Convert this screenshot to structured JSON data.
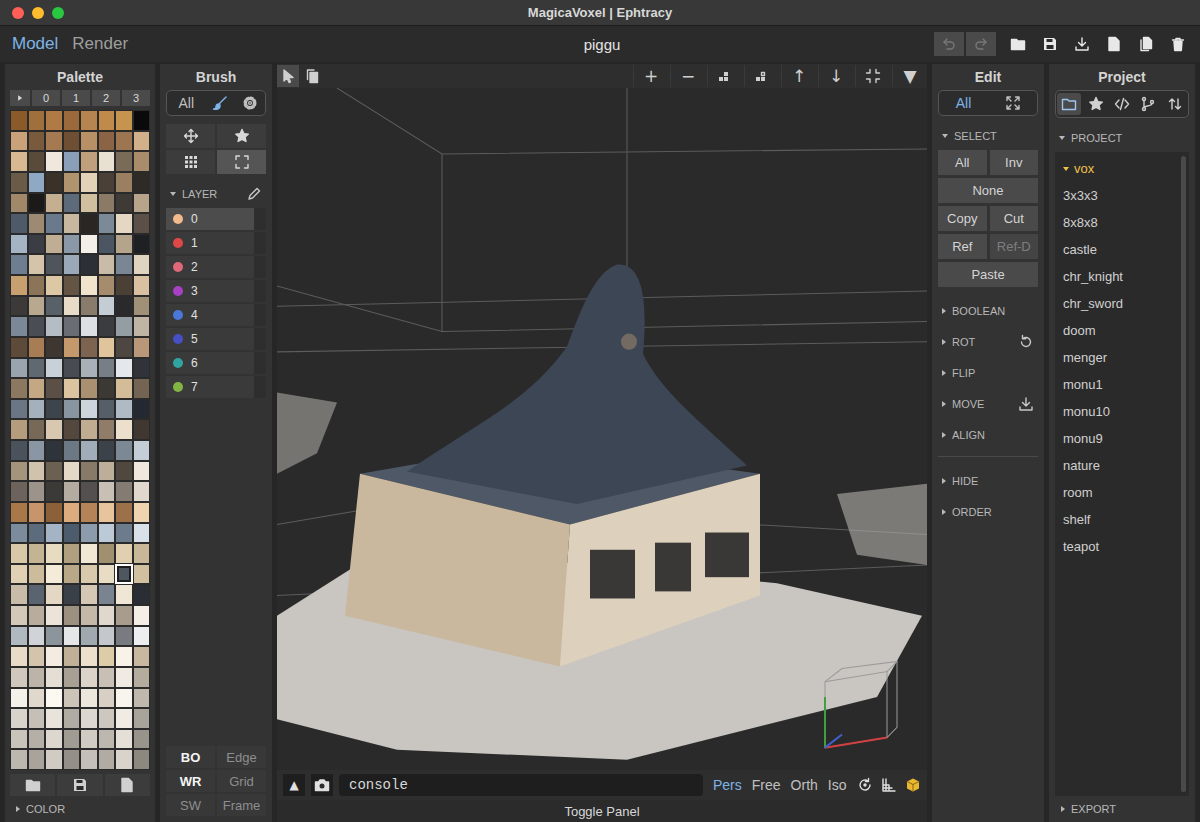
{
  "window": {
    "title": "MagicaVoxel | Ephtracy"
  },
  "mode_tabs": [
    {
      "label": "Model",
      "selected": true
    },
    {
      "label": "Render",
      "selected": false
    }
  ],
  "document": {
    "name": "piggu"
  },
  "history": [
    {
      "kind": "undo",
      "disabled": true
    },
    {
      "kind": "redo",
      "disabled": true
    }
  ],
  "file_actions": [
    {
      "kind": "folder"
    },
    {
      "kind": "save"
    },
    {
      "kind": "download"
    },
    {
      "kind": "file"
    },
    {
      "kind": "files"
    },
    {
      "kind": "trash"
    }
  ],
  "palette": {
    "title": "Palette",
    "pages": [
      {
        "kind": "play",
        "selected": false
      },
      {
        "kind": "text",
        "label": "0",
        "selected": false
      },
      {
        "kind": "text",
        "label": "1",
        "selected": false
      },
      {
        "kind": "text",
        "label": "2",
        "selected": false
      },
      {
        "kind": "text",
        "label": "3",
        "selected": false
      }
    ],
    "rows": [
      [
        "#8b5a2b",
        "#a0703c",
        "#b07a44",
        "#9c6a3a",
        "#b5844f",
        "#c08a4a",
        "#c79450",
        "#0a0a0a"
      ],
      [
        "#c9a27a",
        "#7a5a3c",
        "#a57a52",
        "#6e4f34",
        "#b89066",
        "#8a6444",
        "#9d7550",
        "#d2b08a"
      ],
      [
        "#d8b890",
        "#5a4a3a",
        "#f0e8dc",
        "#8aa0b8",
        "#c0a07c",
        "#e8e0d0",
        "#7a6a58",
        "#a88c6c"
      ],
      [
        "#6a5a48",
        "#8fa8c4",
        "#3a3228",
        "#b0946e",
        "#e2d2b8",
        "#4a4038",
        "#9a8060",
        "#2e2a26"
      ],
      [
        "#a08868",
        "#1c1a18",
        "#c4b090",
        "#5c6a7a",
        "#d0c0a0",
        "#8a7a66",
        "#3e3a36",
        "#b8a48a"
      ],
      [
        "#4e5a68",
        "#9c8a72",
        "#6a7a8c",
        "#c8b8a0",
        "#2a2624",
        "#7c8a98",
        "#e4d8c4",
        "#5a5048"
      ],
      [
        "#a4b4c4",
        "#3a3e44",
        "#c0ae94",
        "#8a98a8",
        "#f4f0e8",
        "#4c5662",
        "#b4a48c",
        "#1e2024"
      ],
      [
        "#6e7e90",
        "#d4c4aa",
        "#50555c",
        "#9aa8b8",
        "#2c3036",
        "#c8bca8",
        "#7a8694",
        "#e0d4c0"
      ],
      [
        "#c8a070",
        "#8c7458",
        "#dcc8a4",
        "#645444",
        "#f0e4cc",
        "#a48c6c",
        "#4a4036",
        "#d8c0a0"
      ],
      [
        "#3c3a38",
        "#b8a890",
        "#586068",
        "#e8dcc8",
        "#8a7c6c",
        "#c4ccd4",
        "#2a2a2c",
        "#a09078"
      ],
      [
        "#7a8898",
        "#4a4e54",
        "#b4bcc4",
        "#6a6e74",
        "#dce0e4",
        "#3a3c40",
        "#949ca4",
        "#c0b4a4"
      ],
      [
        "#5e4a38",
        "#a87c54",
        "#3e3630",
        "#c49a6c",
        "#7c6450",
        "#e0c49c",
        "#4e4640",
        "#b89878"
      ],
      [
        "#9aa4ae",
        "#606870",
        "#c8d0d8",
        "#484c52",
        "#a8b0b8",
        "#787e86",
        "#e4e8ec",
        "#30343a"
      ],
      [
        "#8c7860",
        "#c4a884",
        "#5c5046",
        "#dcc4a0",
        "#a89070",
        "#3c3834",
        "#d4bc98",
        "#746454"
      ],
      [
        "#6a7684",
        "#a4b0bc",
        "#3e444c",
        "#8894a0",
        "#ccd4dc",
        "#565e68",
        "#b0bac4",
        "#242830"
      ],
      [
        "#b49c7c",
        "#786858",
        "#d8c8b0",
        "#54483e",
        "#c0ac90",
        "#907c68",
        "#ece0cc",
        "#403830"
      ],
      [
        "#4a525c",
        "#8a96a4",
        "#2e343a",
        "#6c7884",
        "#a0acb8",
        "#3c424a",
        "#7c8894",
        "#c4ccd6"
      ],
      [
        "#a4947c",
        "#d0c2ac",
        "#6c6052",
        "#e4d8c6",
        "#887a68",
        "#bcae98",
        "#50483e",
        "#f0e8dc"
      ],
      [
        "#6c645c",
        "#9c948a",
        "#3c3a36",
        "#b4aca0",
        "#545050",
        "#c8c0b4",
        "#847c72",
        "#e0d8cc"
      ],
      [
        "#a87848",
        "#c8946c",
        "#8c6038",
        "#dcac7c",
        "#b48458",
        "#e8c49c",
        "#9c7048",
        "#f0d4b0"
      ],
      [
        "#7c8c9c",
        "#5c6c7c",
        "#a4b4c4",
        "#4c5c6c",
        "#8c9cac",
        "#bccad8",
        "#6c7c8c",
        "#d8e0e8"
      ],
      [
        "#d8c8a8",
        "#c4b494",
        "#e8dcc0",
        "#b0a080",
        "#f0e8d4",
        "#a09070",
        "#e0d0b0",
        "#c8b898"
      ],
      [
        "#e0d0b4",
        "#ccbc9c",
        "#f4ecd8",
        "#b8a888",
        "#d8c8ac",
        "#e8dcc4",
        "#4e5660",
        "#d0c0a0"
      ],
      [
        "#c8bca8",
        "#5a6470",
        "#e4d8c4",
        "#3a4048",
        "#d4c8b4",
        "#7a8490",
        "#f0e6d6",
        "#2a2e34"
      ],
      [
        "#d4c8b8",
        "#b8ac9c",
        "#ece4d8",
        "#9c9080",
        "#c4b8a8",
        "#e0d8cc",
        "#a89c8c",
        "#f4eee6"
      ],
      [
        "#b0b8c0",
        "#d0d4d8",
        "#8c949c",
        "#e4e6e8",
        "#a0a8b0",
        "#c4c8cc",
        "#787c80",
        "#eceef0"
      ],
      [
        "#e8dcc8",
        "#d4c4ac",
        "#f4ece0",
        "#c0b098",
        "#ece0cc",
        "#dccca8",
        "#f8f2e8",
        "#c8b8a0"
      ],
      [
        "#d0c8bc",
        "#bcb4a8",
        "#e4ded4",
        "#a8a094",
        "#dcd4c8",
        "#c8c0b4",
        "#f0eae2",
        "#b4ac9c"
      ],
      [
        "#f4f0ea",
        "#e0d8cc",
        "#fcf8f2",
        "#ccc4b8",
        "#ece6dc",
        "#d8d0c4",
        "#f8f4ee",
        "#c0b8ac"
      ],
      [
        "#d8d4cc",
        "#c4c0b8",
        "#e8e4dc",
        "#b0aca4",
        "#dcd8d0",
        "#ccc8c0",
        "#f0ece4",
        "#a8a49c"
      ],
      [
        "#c8c4bc",
        "#b4b0a8",
        "#dcd8d0",
        "#a09c94",
        "#d0ccc4",
        "#bcb8b0",
        "#e4e0d8",
        "#98948c"
      ],
      [
        "#bcb8b0",
        "#a8a49c",
        "#d0ccc4",
        "#948f88",
        "#c4c0b8",
        "#b0aca4",
        "#d8d4cc",
        "#8c8880"
      ]
    ],
    "selected_swatch": {
      "row": 22,
      "col": 6
    },
    "footer": {
      "label": "COLOR",
      "expanded": false
    }
  },
  "brush": {
    "title": "Brush",
    "modes": [
      {
        "kind": "text",
        "label": "All",
        "selected": false
      },
      {
        "kind": "brush",
        "selected": true
      },
      {
        "kind": "gear",
        "selected": false
      }
    ],
    "tools": [
      {
        "kind": "move",
        "selected": false
      },
      {
        "kind": "star",
        "selected": false
      },
      {
        "kind": "grid",
        "selected": false
      },
      {
        "kind": "select",
        "selected": true
      }
    ],
    "layers": {
      "label": "LAYER",
      "expanded": true,
      "items": [
        {
          "label": "0",
          "color": "#f2b98c",
          "selected": true
        },
        {
          "label": "1",
          "color": "#e04848",
          "selected": false
        },
        {
          "label": "2",
          "color": "#e06878",
          "selected": false
        },
        {
          "label": "3",
          "color": "#a840c4",
          "selected": false
        },
        {
          "label": "4",
          "color": "#4a78d8",
          "selected": false
        },
        {
          "label": "5",
          "color": "#4650c4",
          "selected": false
        },
        {
          "label": "6",
          "color": "#30a4a0",
          "selected": false
        },
        {
          "label": "7",
          "color": "#84b444",
          "selected": false
        }
      ]
    },
    "view_options": [
      {
        "label": "BO",
        "on": true
      },
      {
        "label": "Edge",
        "on": false
      },
      {
        "label": "WR",
        "on": true
      },
      {
        "label": "Grid",
        "on": false
      },
      {
        "label": "SW",
        "on": false
      },
      {
        "label": "Frame",
        "on": false
      }
    ]
  },
  "viewport": {
    "tools": [
      {
        "kind": "cursor",
        "selected": true
      },
      {
        "kind": "copy",
        "selected": false
      }
    ],
    "view_buttons": [
      {
        "kind": "glyph",
        "label": "+"
      },
      {
        "kind": "glyph",
        "label": "−"
      },
      {
        "kind": "voxel-in"
      },
      {
        "kind": "voxel-out"
      },
      {
        "kind": "glyph",
        "label": "↑"
      },
      {
        "kind": "glyph",
        "label": "↓"
      },
      {
        "kind": "fit"
      },
      {
        "kind": "glyph",
        "label": "▼"
      }
    ],
    "panel_button": {
      "label": "▲"
    },
    "console": {
      "placeholder": "console"
    },
    "projections": [
      {
        "label": "Pers",
        "selected": true
      },
      {
        "label": "Free",
        "selected": false
      },
      {
        "label": "Orth",
        "selected": false
      },
      {
        "label": "Iso",
        "selected": false
      }
    ],
    "view_icons": [
      {
        "kind": "rotate"
      },
      {
        "kind": "plane"
      },
      {
        "kind": "cube"
      }
    ],
    "toggle": {
      "label": "Toggle Panel"
    }
  },
  "edit": {
    "title": "Edit",
    "modes": [
      {
        "kind": "text",
        "label": "All",
        "selected": true
      },
      {
        "kind": "expand",
        "selected": false
      }
    ],
    "select": {
      "label": "SELECT",
      "expanded": true,
      "rows": [
        [
          {
            "label": "All",
            "disabled": false
          },
          {
            "label": "Inv",
            "disabled": false
          }
        ],
        [
          {
            "label": "None",
            "disabled": false
          }
        ],
        [
          {
            "label": "Copy",
            "disabled": false
          },
          {
            "label": "Cut",
            "disabled": false
          }
        ],
        [
          {
            "label": "Ref",
            "disabled": false
          },
          {
            "label": "Ref-D",
            "disabled": true
          }
        ],
        [
          {
            "label": "Paste",
            "disabled": false
          }
        ]
      ]
    },
    "section_groups": [
      [
        {
          "label": "BOOLEAN",
          "expanded": false,
          "kind": "plain"
        },
        {
          "label": "ROT",
          "expanded": false,
          "kind": "reset"
        },
        {
          "label": "FLIP",
          "expanded": false,
          "kind": "plain"
        },
        {
          "label": "MOVE",
          "expanded": false,
          "kind": "download"
        },
        {
          "label": "ALIGN",
          "expanded": false,
          "kind": "plain"
        }
      ],
      [
        {
          "label": "HIDE",
          "expanded": false,
          "kind": "plain"
        },
        {
          "label": "ORDER",
          "expanded": false,
          "kind": "plain"
        }
      ]
    ]
  },
  "project": {
    "title": "Project",
    "tabs": [
      {
        "kind": "folder-outline",
        "selected": true
      },
      {
        "kind": "star",
        "selected": false
      },
      {
        "kind": "code",
        "selected": false
      },
      {
        "kind": "tree",
        "selected": false
      },
      {
        "kind": "sort",
        "selected": false
      }
    ],
    "section": {
      "label": "PROJECT",
      "expanded": true
    },
    "folder": {
      "label": "vox",
      "expanded": true,
      "selected": true
    },
    "files": [
      "3x3x3",
      "8x8x8",
      "castle",
      "chr_knight",
      "chr_sword",
      "doom",
      "menger",
      "monu1",
      "monu10",
      "monu9",
      "nature",
      "room",
      "shelf",
      "teapot"
    ],
    "footer": {
      "label": "EXPORT",
      "expanded": false
    }
  }
}
